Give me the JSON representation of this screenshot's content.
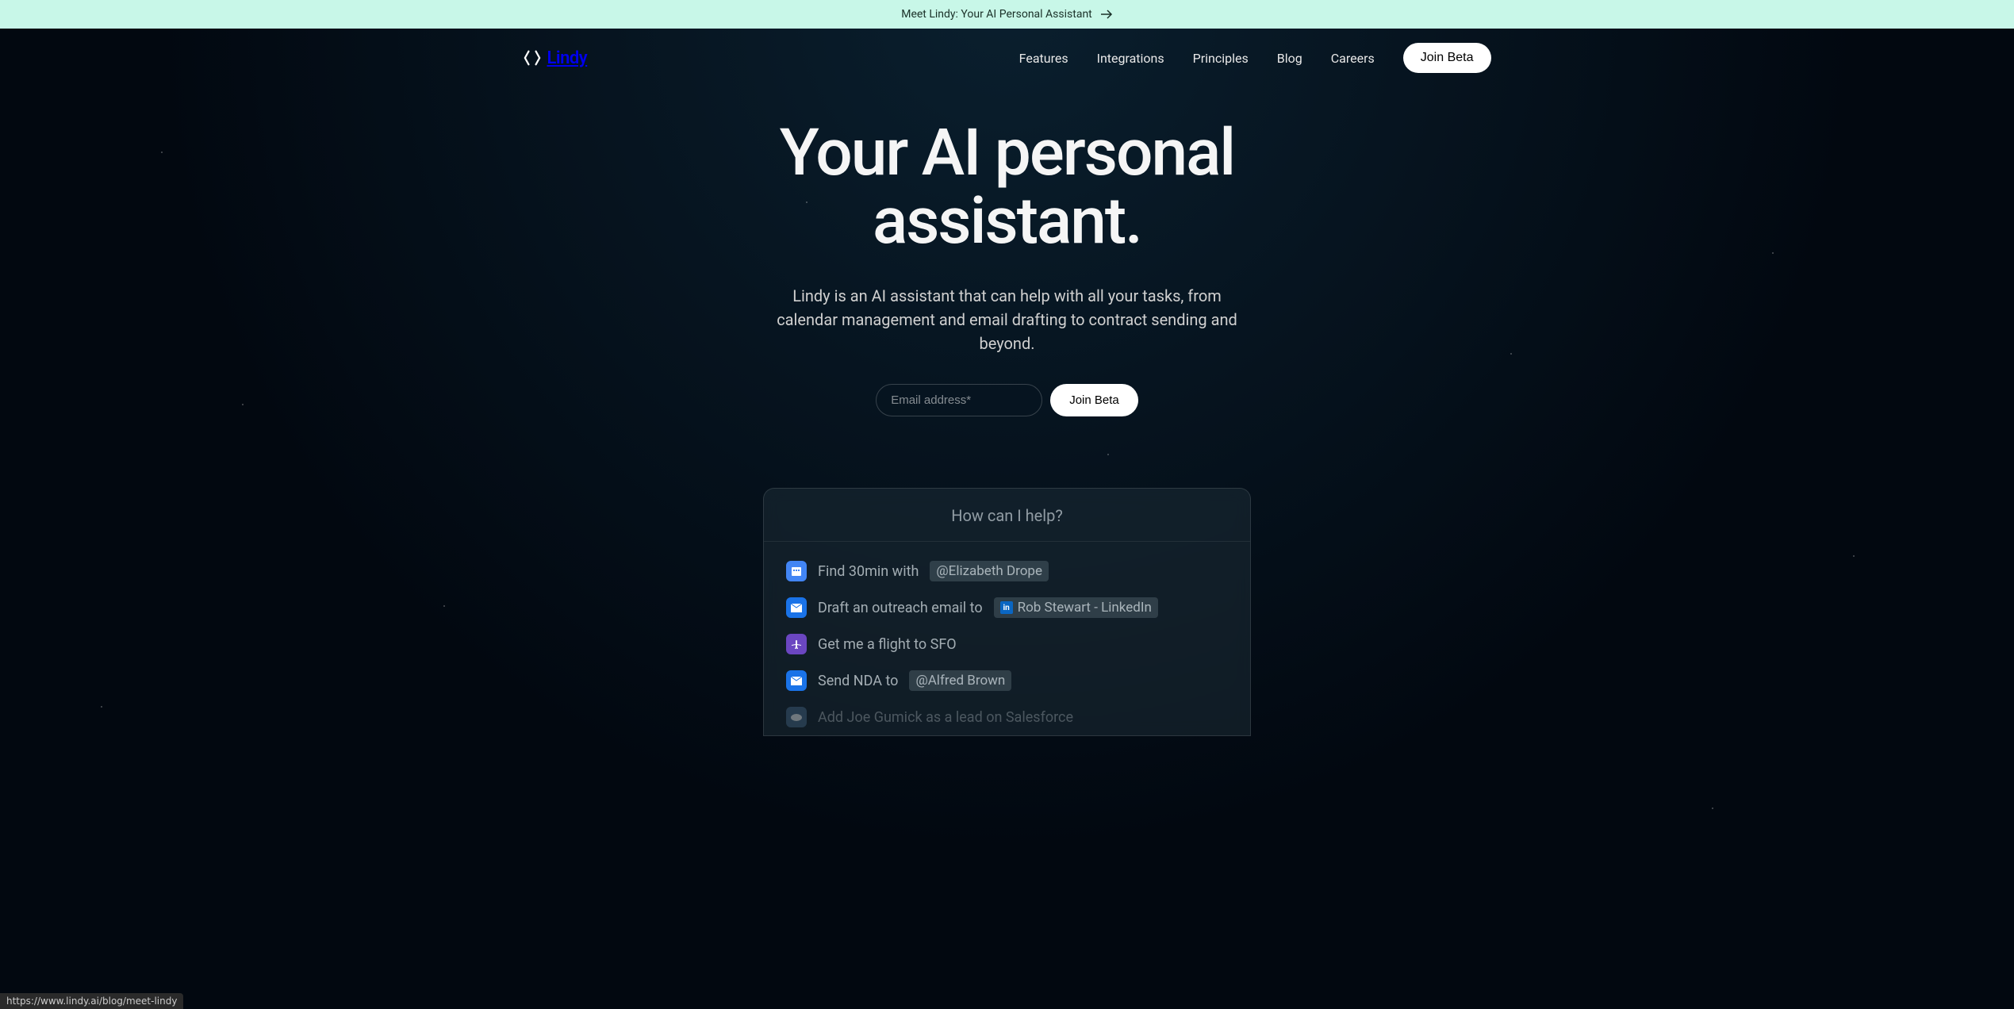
{
  "announcement": {
    "text": "Meet Lindy: Your AI Personal Assistant"
  },
  "brand": {
    "name": "Lindy"
  },
  "nav": {
    "links": [
      {
        "label": "Features"
      },
      {
        "label": "Integrations"
      },
      {
        "label": "Principles"
      },
      {
        "label": "Blog"
      },
      {
        "label": "Careers"
      }
    ],
    "cta": "Join Beta"
  },
  "hero": {
    "title_line1": "Your AI personal",
    "title_line2": "assistant.",
    "subtitle": "Lindy is an AI assistant that can help with all your tasks, from calendar management and email drafting to contract sending and beyond.",
    "email_placeholder": "Email address*",
    "submit_label": "Join Beta"
  },
  "widget": {
    "prompt": "How can I help?",
    "items": [
      {
        "icon": "calendar",
        "text_before": "Find 30min with",
        "tag": "@Elizabeth Drope"
      },
      {
        "icon": "mail",
        "text_before": "Draft an outreach email to",
        "tag": "Rob Stewart - LinkedIn",
        "tag_icon": "linkedin"
      },
      {
        "icon": "flight",
        "text_before": "Get me a flight to SFO"
      },
      {
        "icon": "mail",
        "text_before": "Send NDA to",
        "tag": "@Alfred Brown"
      },
      {
        "icon": "salesforce",
        "text_before": "Add Joe Gumick as a lead on Salesforce"
      }
    ]
  },
  "status_url": "https://www.lindy.ai/blog/meet-lindy"
}
